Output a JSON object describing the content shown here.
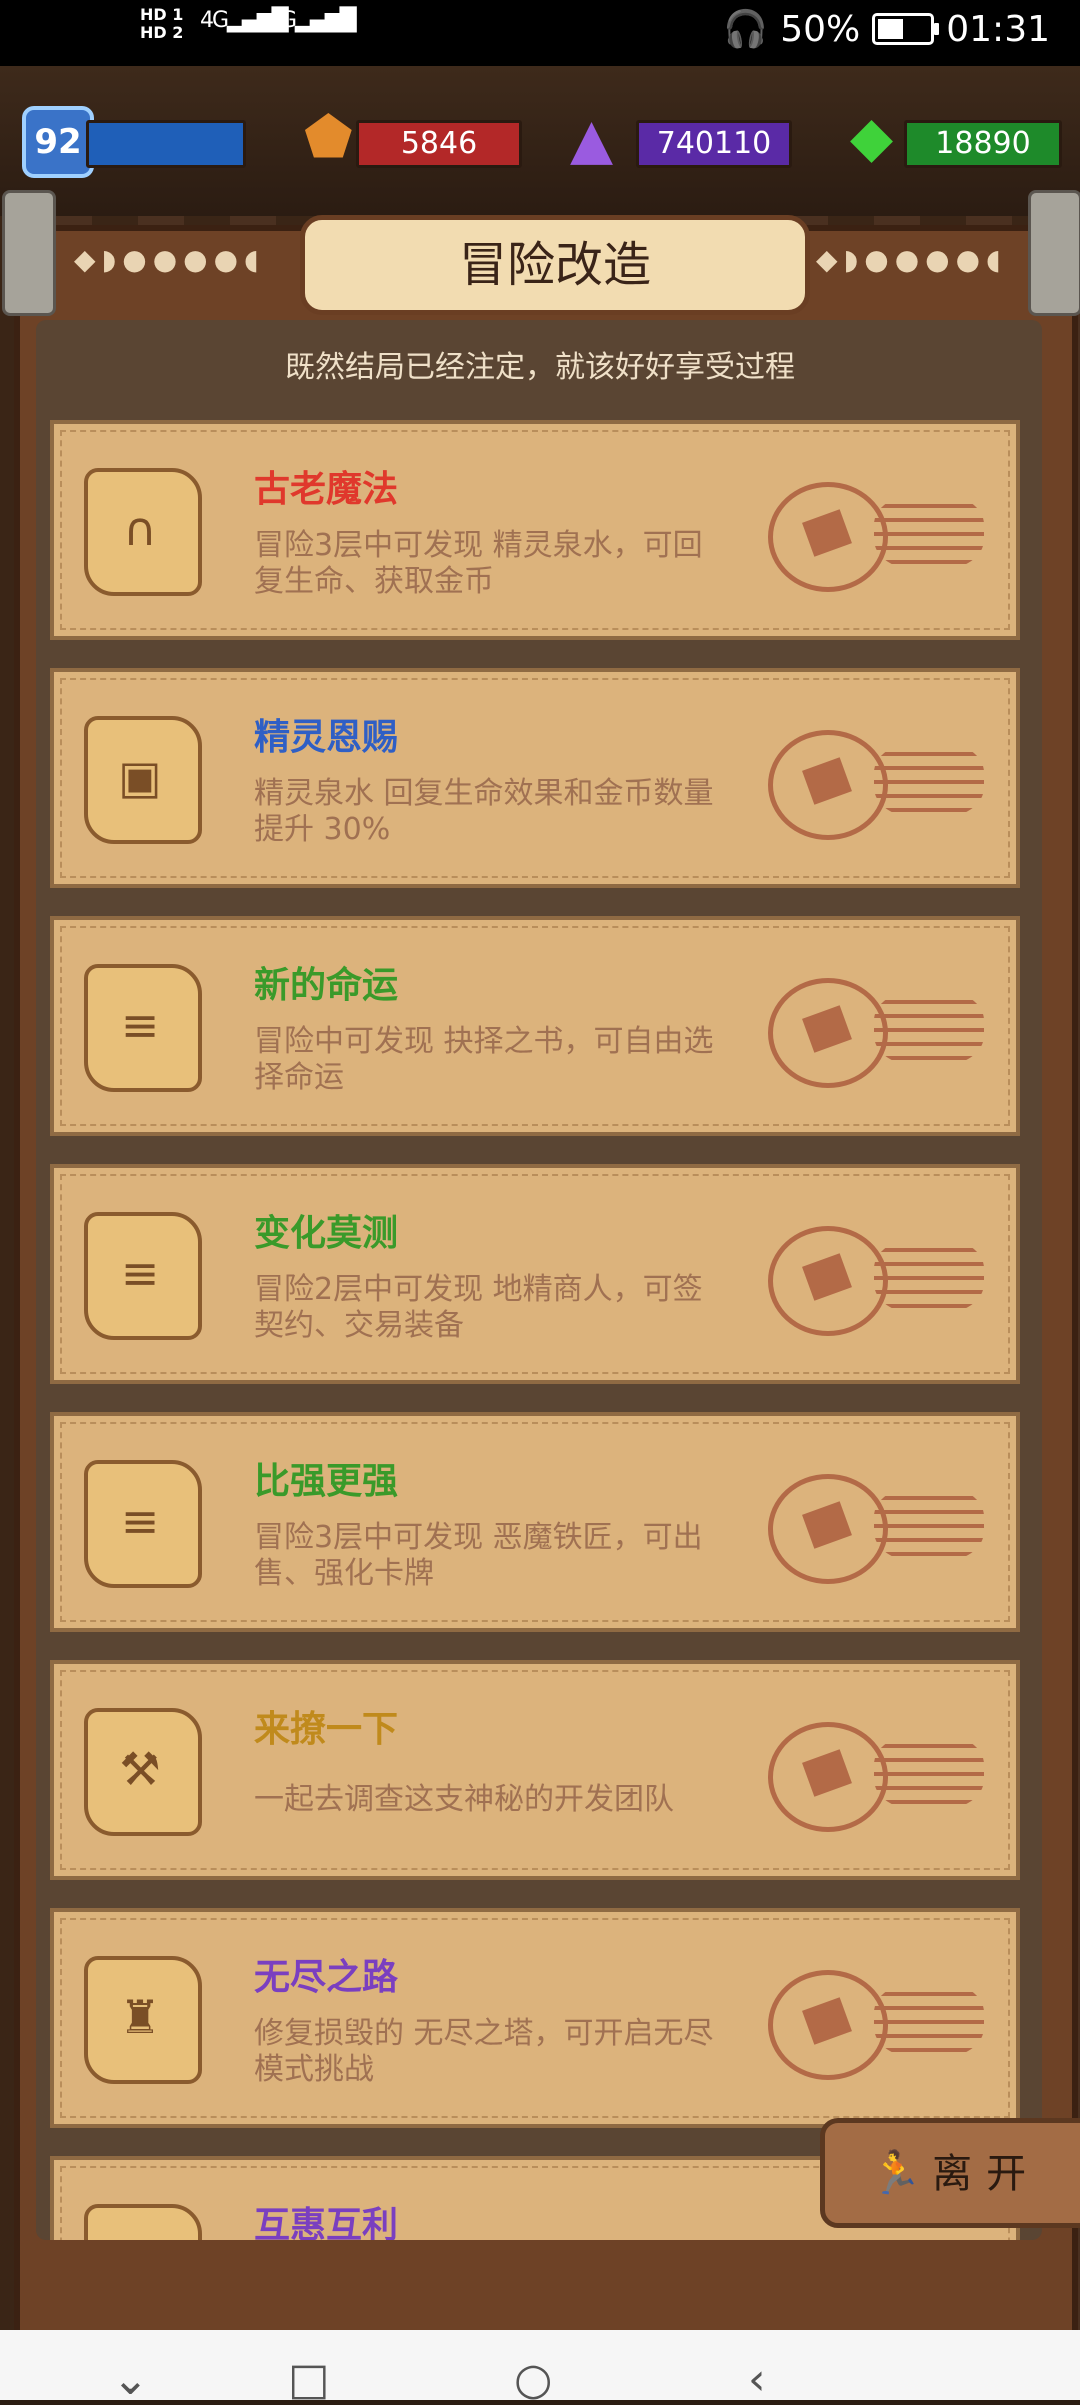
{
  "status": {
    "sim1": "HD 1",
    "sim2": "HD 2",
    "net1": "4G",
    "net2": "4G",
    "battery": "50%",
    "time": "01:31"
  },
  "resources": {
    "level": "92",
    "gold": "5846",
    "crystal": "740110",
    "emerald": "18890"
  },
  "page": {
    "title": "冒险改造",
    "subtitle": "既然结局已经注定，就该好好享受过程"
  },
  "upgrades": [
    {
      "title": "古老魔法",
      "desc": "冒险3层中可发现 精灵泉水，可回复生命、获取金币",
      "color": "#e0382c",
      "icon": "arch-icon"
    },
    {
      "title": "精灵恩赐",
      "desc": "精灵泉水 回复生命效果和金币数量 提升 30%",
      "color": "#2f5fc5",
      "icon": "box-icon"
    },
    {
      "title": "新的命运",
      "desc": "冒险中可发现 抉择之书，可自由选择命运",
      "color": "#3a9a2a",
      "icon": "book-icon"
    },
    {
      "title": "变化莫测",
      "desc": "冒险2层中可发现 地精商人，可签契约、交易装备",
      "color": "#3a9a2a",
      "icon": "book-icon"
    },
    {
      "title": "比强更强",
      "desc": "冒险3层中可发现 恶魔铁匠，可出售、强化卡牌",
      "color": "#3a9a2a",
      "icon": "book-icon"
    },
    {
      "title": "来撩一下",
      "desc": "一起去调查这支神秘的开发团队",
      "color": "#c08a1c",
      "icon": "wrench-icon"
    },
    {
      "title": "无尽之路",
      "desc": "修复损毁的 无尽之塔，可开启无尽模式挑战",
      "color": "#7a3fc0",
      "icon": "hat-icon"
    },
    {
      "title": "互惠互利",
      "desc": "",
      "color": "#7a3fc0",
      "icon": "book-icon"
    }
  ],
  "leave_label": "离开",
  "nav": {
    "back": "‹",
    "home": "○",
    "recent": "□",
    "close": "⌄"
  }
}
